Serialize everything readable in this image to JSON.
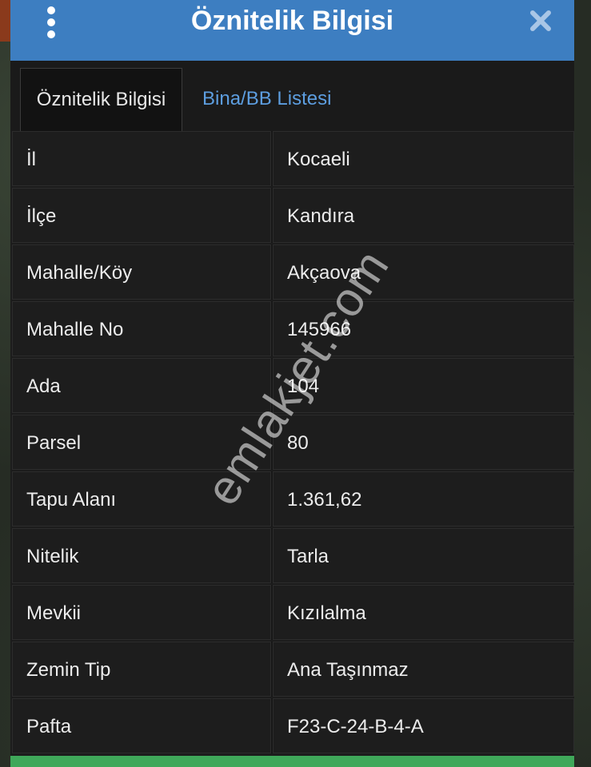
{
  "window": {
    "title": "Öznitelik Bilgisi"
  },
  "tabs": [
    {
      "label": "Öznitelik Bilgisi",
      "active": true
    },
    {
      "label": "Bina/BB Listesi",
      "active": false
    }
  ],
  "rows": [
    {
      "key": "İl",
      "value": "Kocaeli"
    },
    {
      "key": "İlçe",
      "value": "Kandıra"
    },
    {
      "key": "Mahalle/Köy",
      "value": "Akçaova"
    },
    {
      "key": "Mahalle No",
      "value": "145966"
    },
    {
      "key": "Ada",
      "value": "104"
    },
    {
      "key": "Parsel",
      "value": "80"
    },
    {
      "key": "Tapu Alanı",
      "value": "1.361,62"
    },
    {
      "key": "Nitelik",
      "value": "Tarla"
    },
    {
      "key": "Mevkii",
      "value": "Kızılalma"
    },
    {
      "key": "Zemin Tip",
      "value": "Ana Taşınmaz"
    },
    {
      "key": "Pafta",
      "value": "F23-C-24-B-4-A"
    }
  ],
  "watermark": "emlakjet.com",
  "colors": {
    "titlebar": "#3d7ec1",
    "tab_link": "#5d9ee0",
    "panel_bg": "#1c1c1c",
    "bottom_bar": "#3fa85a"
  },
  "icons": {
    "menu": "menu-dots-icon",
    "close": "close-icon"
  }
}
